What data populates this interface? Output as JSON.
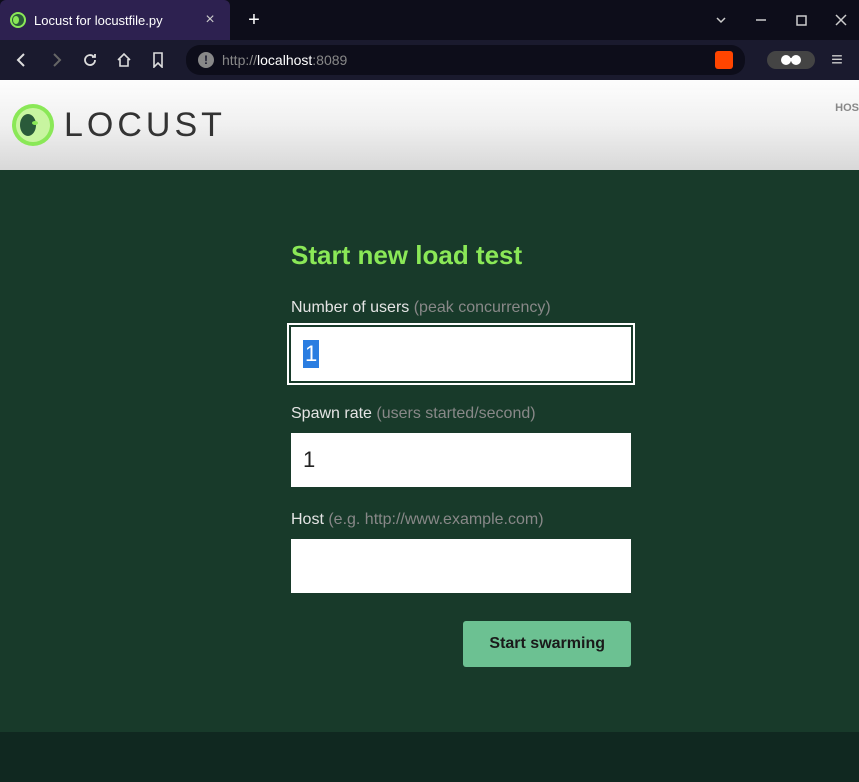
{
  "browser": {
    "tab_title": "Locust for locustfile.py",
    "url_protocol": "http://",
    "url_host": "localhost",
    "url_port": ":8089"
  },
  "header": {
    "logo_text": "LOCUST",
    "host_label": "HOS"
  },
  "form": {
    "title": "Start new load test",
    "users": {
      "label": "Number of users ",
      "hint": "(peak concurrency)",
      "value": "1"
    },
    "spawn_rate": {
      "label": "Spawn rate ",
      "hint": "(users started/second)",
      "value": "1"
    },
    "host": {
      "label": "Host ",
      "hint": "(e.g. http://www.example.com)",
      "value": ""
    },
    "submit_label": "Start swarming"
  }
}
